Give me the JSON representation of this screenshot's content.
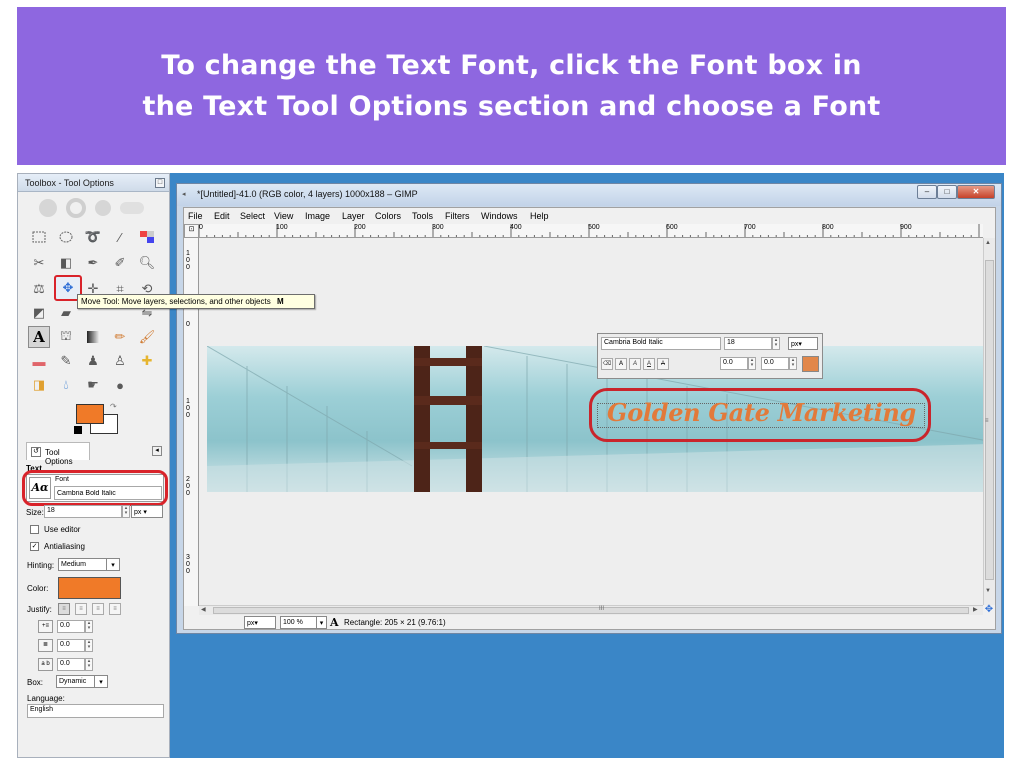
{
  "banner": {
    "line1": "To change the Text Font, click the Font box in",
    "line2": "the Text Tool Options section and choose a Font"
  },
  "toolbox": {
    "title": "Toolbox - Tool Options",
    "tooltip_text": "Move Tool: Move layers, selections, and other objects",
    "tooltip_shortcut": "M",
    "fg_color": "#f07a28",
    "bg_color": "#ffffff"
  },
  "tool_options": {
    "tab_label": "Tool Options",
    "section": "Text",
    "font_label": "Font",
    "font_value": "Cambria Bold Italic",
    "size_label": "Size:",
    "size_value": "18",
    "size_unit": "px",
    "use_editor": "Use editor",
    "use_editor_checked": false,
    "antialiasing": "Antialiasing",
    "antialiasing_checked": true,
    "hinting_label": "Hinting:",
    "hinting_value": "Medium",
    "color_label": "Color:",
    "color_value": "#f07a28",
    "justify_label": "Justify:",
    "indent_value": "0.0",
    "line_spacing_value": "0.0",
    "letter_spacing_value": "0.0",
    "box_label": "Box:",
    "box_value": "Dynamic",
    "language_label": "Language:",
    "language_value": "English"
  },
  "gimp_window": {
    "title": "*[Untitled]-41.0 (RGB color, 4 layers) 1000x188 – GIMP",
    "menus": [
      "File",
      "Edit",
      "Select",
      "View",
      "Image",
      "Layer",
      "Colors",
      "Tools",
      "Filters",
      "Windows",
      "Help"
    ],
    "ruler_marks": [
      "0",
      "100",
      "200",
      "300",
      "400",
      "500",
      "600",
      "700",
      "800",
      "900"
    ],
    "vruler_marks": [
      "1\n0\n0",
      "0",
      "1\n0\n0",
      "2\n0\n0",
      "3\n0\n0"
    ],
    "canvas_text": "Golden Gate Marketing",
    "canvas_text_color": "#e27a3a",
    "onscreen_font": "Cambria Bold Italic",
    "onscreen_size": "18",
    "onscreen_unit": "px",
    "onscreen_val1": "0.0",
    "onscreen_val2": "0.0",
    "status_unit": "px",
    "status_zoom": "100 %",
    "status_text": "Rectangle: 205 × 21  (9.76:1)",
    "scroll_mid": "III"
  }
}
